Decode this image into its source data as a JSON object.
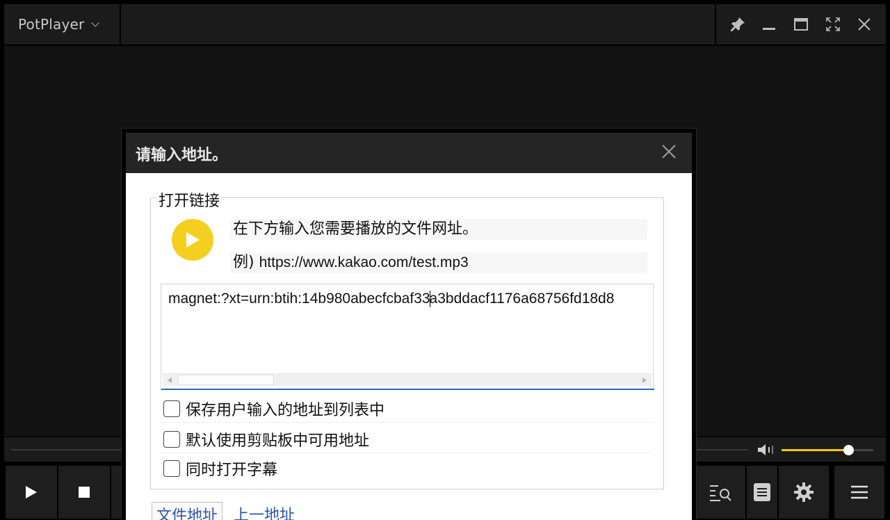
{
  "app": {
    "title": "PotPlayer",
    "menu_icon": "chevron-down-icon"
  },
  "window_controls": [
    {
      "name": "pin-button",
      "icon": "pin-icon"
    },
    {
      "name": "minimize-button",
      "icon": "minimize-icon"
    },
    {
      "name": "maximize-button",
      "icon": "maximize-icon"
    },
    {
      "name": "fullscreen-button",
      "icon": "fullscreen-icon"
    },
    {
      "name": "close-button",
      "icon": "close-icon"
    }
  ],
  "volume": {
    "level": 0.73,
    "accent": "#f5c800"
  },
  "controls": {
    "left": [
      "play-icon",
      "stop-icon"
    ],
    "right": [
      "playlist-search-icon",
      "playlist-icon",
      "settings-gear-icon",
      "hamburger-menu-icon"
    ]
  },
  "dialog": {
    "title": "请输入地址。",
    "group_label": "打开链接",
    "instruction": "在下方输入您需要播放的文件网址。",
    "example_prefix": "例)",
    "example_url": "https://www.kakao.com/test.mp3",
    "url_value_before_caret": "magnet:?xt=urn:btih:14b980abecfcbaf33",
    "url_value_after_caret": "a3bddacf1176a68756fd18d8",
    "options": [
      {
        "label": "保存用户输入的地址到列表中",
        "checked": false
      },
      {
        "label": "默认使用剪贴板中可用地址",
        "checked": false
      },
      {
        "label": "同时打开字幕",
        "checked": false
      }
    ],
    "tabs": [
      {
        "label": "文件地址",
        "active": true
      },
      {
        "label": "上一地址",
        "active": false
      }
    ],
    "accent_color": "#f5cf1f"
  }
}
